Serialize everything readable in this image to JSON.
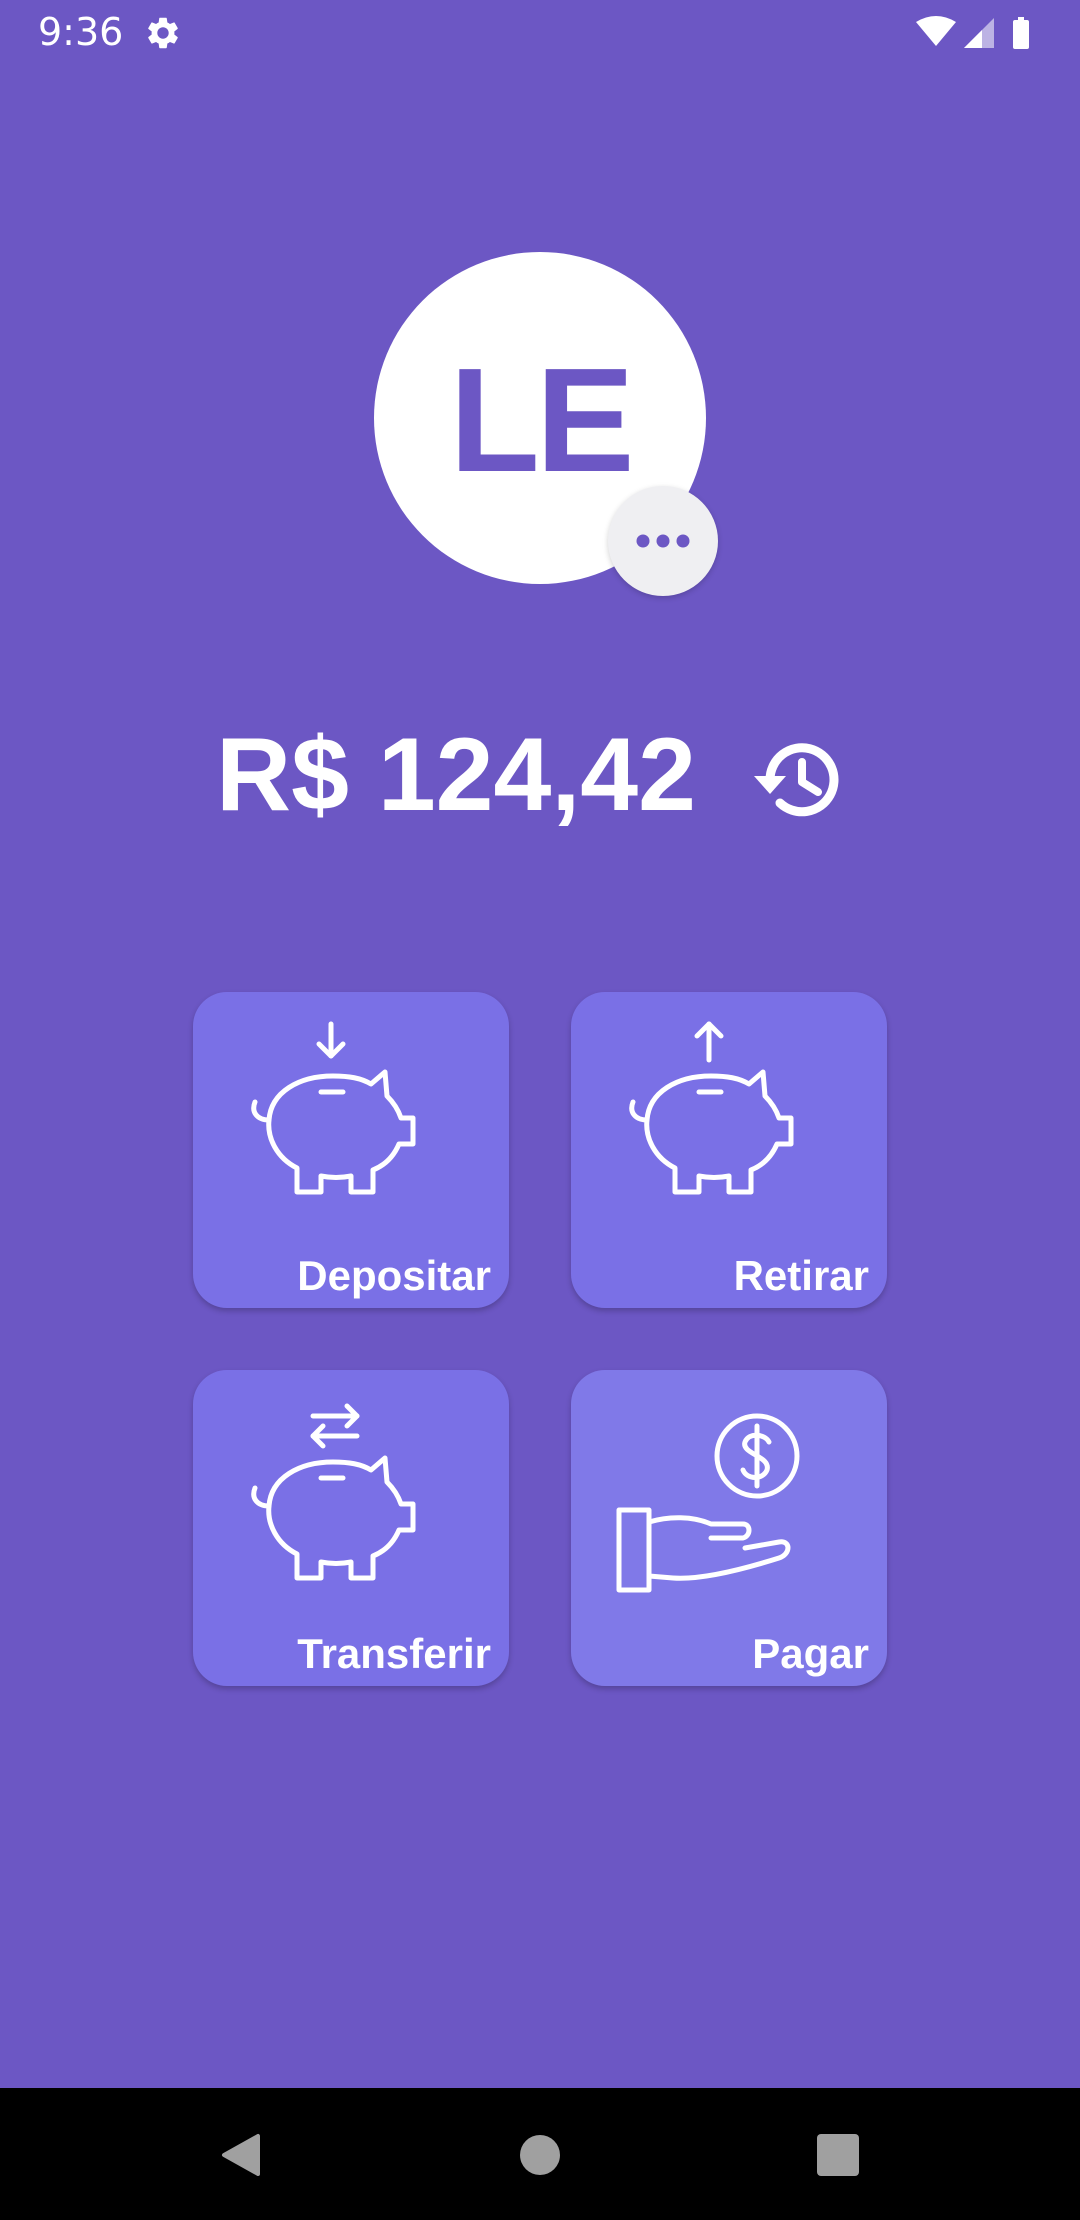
{
  "status_bar": {
    "time": "9:36",
    "icons": [
      "gear-icon",
      "wifi-icon",
      "cell-signal-icon",
      "battery-icon"
    ]
  },
  "profile": {
    "initials": "LE",
    "menu_icon": "more-horizontal-icon"
  },
  "balance": {
    "amount": "R$ 124,42",
    "history_icon": "history-icon"
  },
  "actions": [
    {
      "label": "Depositar",
      "icon": "piggy-bank-deposit-icon"
    },
    {
      "label": "Retirar",
      "icon": "piggy-bank-withdraw-icon"
    },
    {
      "label": "Transferir",
      "icon": "piggy-bank-transfer-icon"
    },
    {
      "label": "Pagar",
      "icon": "hand-coin-pay-icon"
    }
  ],
  "nav": [
    "back-icon",
    "home-icon",
    "recents-icon"
  ],
  "colors": {
    "background": "#6c57c4",
    "tile": "#7a70e6",
    "tile_pay": "#8079e8",
    "white": "#ffffff",
    "nav_bar": "#000000"
  }
}
